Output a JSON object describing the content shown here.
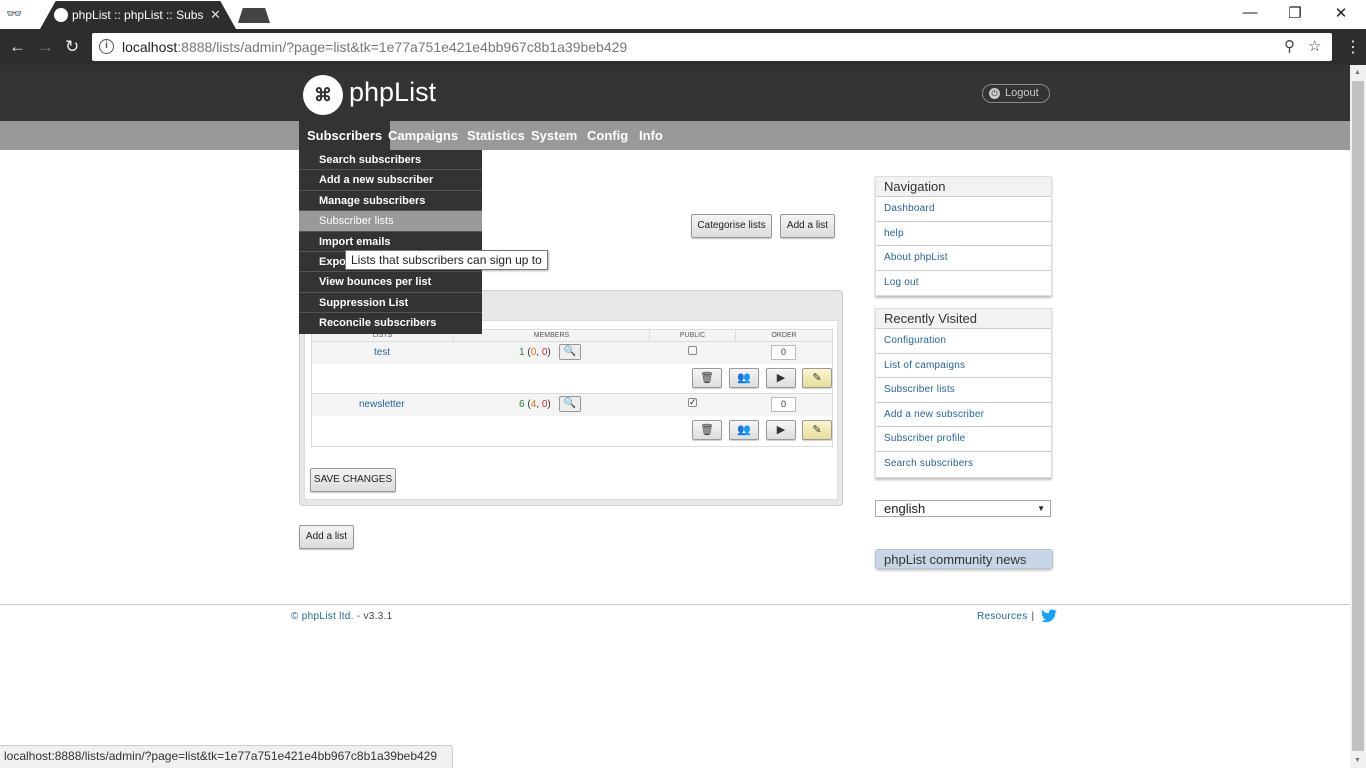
{
  "browser": {
    "tab_title": "phpList :: phpList :: Subsc",
    "url_host": "localhost",
    "url_rest": ":8888/lists/admin/?page=list&tk=1e77a751e421e4bb967c8b1a39beb429",
    "status_url": "localhost:8888/lists/admin/?page=list&tk=1e77a751e421e4bb967c8b1a39beb429"
  },
  "header": {
    "logo_text": "phpList",
    "logout_label": "Logout"
  },
  "mainnav": [
    "Subscribers",
    "Campaigns",
    "Statistics",
    "System",
    "Config",
    "Info"
  ],
  "dropdown": [
    "Search subscribers",
    "Add a new subscriber",
    "Manage subscribers",
    "Subscriber lists",
    "Import emails",
    "Expo",
    "View bounces per list",
    "Suppression List",
    "Reconcile subscribers"
  ],
  "tooltip": "Lists that subscribers can sign up to",
  "buttons": {
    "categorise": "Categorise lists",
    "add_list": "Add a list",
    "save_changes": "SAVE CHANGES",
    "add_list_bottom": "Add a list"
  },
  "table": {
    "headers": {
      "name": "LISTS",
      "members": "MEMBERS",
      "public": "PUBLIC",
      "order": "ORDER"
    },
    "rows": [
      {
        "name": "test",
        "members": "1",
        "unconfirmed": "0",
        "blacklisted": "0",
        "public": false,
        "order": "0"
      },
      {
        "name": "newsletter",
        "members": "6",
        "unconfirmed": "4",
        "blacklisted": "0",
        "public": true,
        "order": "0"
      }
    ]
  },
  "sidebar": {
    "navigation": {
      "title": "Navigation",
      "links": [
        "Dashboard",
        "help",
        "About phpList",
        "Log out"
      ]
    },
    "recent": {
      "title": "Recently Visited",
      "links": [
        "Configuration",
        "List of campaigns",
        "Subscriber lists",
        "Add a new subscriber",
        "Subscriber profile",
        "Search subscribers"
      ]
    },
    "language": "english",
    "news_title": "phpList community news"
  },
  "footer": {
    "copyright": "© phpList ltd.",
    "version": " - v3.3.1",
    "resources": "Resources",
    "separator": "|"
  },
  "colors": {
    "header_bg": "#333333",
    "nav_bg": "#999999",
    "link": "#2a6496",
    "news_bg": "#c8d5e6"
  }
}
